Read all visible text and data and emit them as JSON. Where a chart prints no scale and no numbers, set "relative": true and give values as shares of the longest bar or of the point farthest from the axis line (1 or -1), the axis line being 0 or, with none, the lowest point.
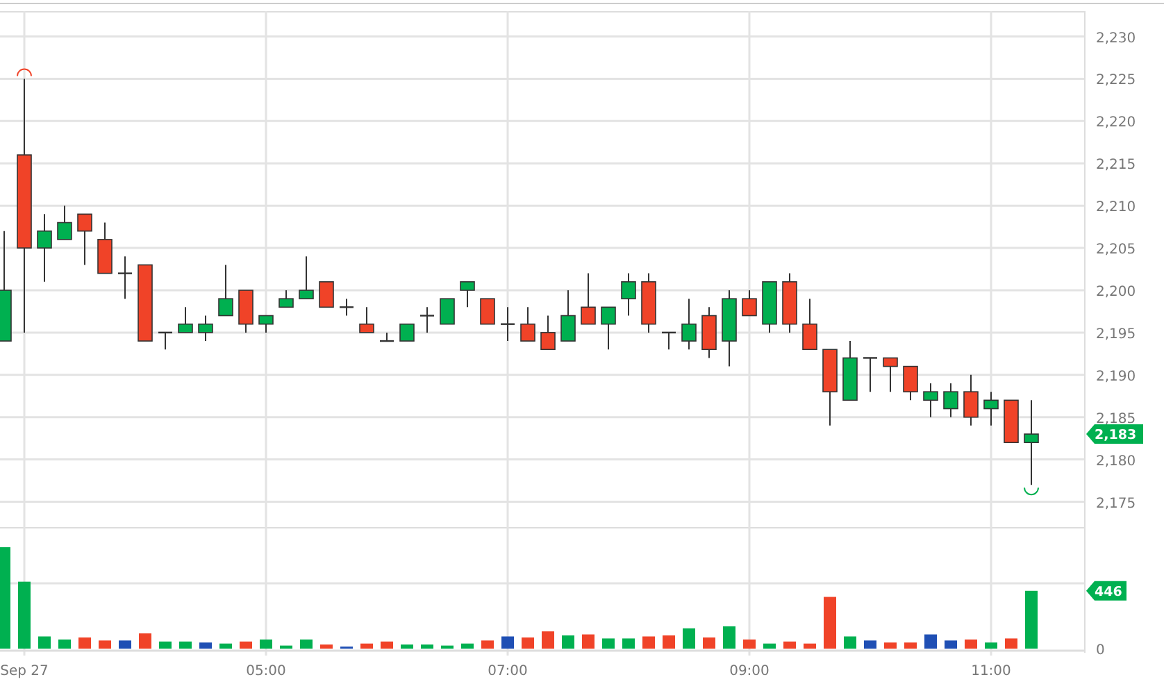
{
  "price_chart": {
    "chart_data": {
      "type": "candlestick",
      "grid": true,
      "ohlc": [
        [
          2194,
          2207,
          2194,
          2200
        ],
        [
          2216,
          2225,
          2195,
          2205
        ],
        [
          2205,
          2209,
          2201,
          2207
        ],
        [
          2206,
          2210,
          2206,
          2208
        ],
        [
          2209,
          2209,
          2203,
          2207
        ],
        [
          2206,
          2208,
          2202,
          2202
        ],
        [
          2202,
          2204,
          2199,
          2202
        ],
        [
          2203,
          2203,
          2194,
          2194
        ],
        [
          2195,
          2195,
          2193,
          2195
        ],
        [
          2195,
          2198,
          2195,
          2196
        ],
        [
          2195,
          2197,
          2194,
          2196
        ],
        [
          2197,
          2203,
          2197,
          2199
        ],
        [
          2200,
          2200,
          2195,
          2196
        ],
        [
          2196,
          2197,
          2195,
          2197
        ],
        [
          2198,
          2200,
          2198,
          2199
        ],
        [
          2199,
          2204,
          2199,
          2200
        ],
        [
          2201,
          2201,
          2198,
          2198
        ],
        [
          2198,
          2199,
          2197,
          2198
        ],
        [
          2196,
          2198,
          2195,
          2195
        ],
        [
          2194,
          2195,
          2194,
          2194
        ],
        [
          2194,
          2196,
          2194,
          2196
        ],
        [
          2197,
          2198,
          2195,
          2197
        ],
        [
          2196,
          2199,
          2196,
          2199
        ],
        [
          2200,
          2201,
          2198,
          2201
        ],
        [
          2199,
          2199,
          2196,
          2196
        ],
        [
          2196,
          2198,
          2194,
          2196
        ],
        [
          2196,
          2198,
          2194,
          2194
        ],
        [
          2195,
          2197,
          2193,
          2193
        ],
        [
          2194,
          2200,
          2194,
          2197
        ],
        [
          2198,
          2202,
          2196,
          2196
        ],
        [
          2196,
          2198,
          2193,
          2198
        ],
        [
          2199,
          2202,
          2197,
          2201
        ],
        [
          2201,
          2202,
          2195,
          2196
        ],
        [
          2195,
          2195,
          2193,
          2195
        ],
        [
          2194,
          2199,
          2193,
          2196
        ],
        [
          2197,
          2198,
          2192,
          2193
        ],
        [
          2194,
          2200,
          2191,
          2199
        ],
        [
          2199,
          2200,
          2197,
          2197
        ],
        [
          2196,
          2201,
          2195,
          2201
        ],
        [
          2201,
          2202,
          2195,
          2196
        ],
        [
          2196,
          2199,
          2193,
          2193
        ],
        [
          2193,
          2193,
          2184,
          2188
        ],
        [
          2187,
          2194,
          2187,
          2192
        ],
        [
          2192,
          2192,
          2188,
          2192
        ],
        [
          2192,
          2192,
          2188,
          2191
        ],
        [
          2191,
          2191,
          2187,
          2188
        ],
        [
          2187,
          2189,
          2185,
          2188
        ],
        [
          2186,
          2189,
          2185,
          2188
        ],
        [
          2188,
          2190,
          2184,
          2185
        ],
        [
          2186,
          2188,
          2184,
          2187
        ],
        [
          2187,
          2187,
          2182,
          2182
        ],
        [
          2182,
          2187,
          2177,
          2183
        ]
      ],
      "ylim": [
        2172.25,
        2233
      ],
      "yticks": [
        {
          "value": 2230,
          "label": "2,230"
        },
        {
          "value": 2225,
          "label": "2,225"
        },
        {
          "value": 2220,
          "label": "2,220"
        },
        {
          "value": 2215,
          "label": "2,215"
        },
        {
          "value": 2210,
          "label": "2,210"
        },
        {
          "value": 2205,
          "label": "2,205"
        },
        {
          "value": 2200,
          "label": "2,200"
        },
        {
          "value": 2195,
          "label": "2,195"
        },
        {
          "value": 2190,
          "label": "2,190"
        },
        {
          "value": 2185,
          "label": "2,185"
        },
        {
          "value": 2180,
          "label": "2,180"
        },
        {
          "value": 2175,
          "label": "2,175"
        }
      ],
      "annotations": [
        "2,183"
      ]
    }
  },
  "volume_chart": {
    "chart_data": {
      "type": "bar",
      "relative": true,
      "grid": true,
      "categories": [
        null,
        "Sep 27",
        null,
        null,
        null,
        null,
        null,
        null,
        null,
        null,
        null,
        null,
        null,
        "05:00",
        null,
        null,
        null,
        null,
        null,
        null,
        null,
        null,
        null,
        null,
        null,
        "07:00",
        null,
        null,
        null,
        null,
        null,
        null,
        null,
        null,
        null,
        null,
        null,
        "09:00",
        null,
        null,
        null,
        null,
        null,
        null,
        null,
        null,
        null,
        null,
        null,
        "11:00",
        null,
        null
      ],
      "series": [
        {
          "color": "#00b050",
          "values": [
            1,
            0.66,
            0.12,
            0.09,
            null,
            null,
            null,
            null,
            0.07,
            0.07,
            null,
            0.05,
            null,
            0.09,
            0.03,
            0.09,
            null,
            null,
            null,
            null,
            0.04,
            0.04,
            0.03,
            0.05,
            null,
            null,
            null,
            null,
            0.13,
            null,
            0.1,
            0.1,
            null,
            null,
            0.2,
            null,
            0.22,
            null,
            0.05,
            null,
            null,
            null,
            0.12,
            null,
            null,
            null,
            null,
            null,
            null,
            0.06,
            null,
            0.57
          ]
        },
        {
          "color": "#f04328",
          "values": [
            null,
            null,
            null,
            null,
            0.11,
            0.08,
            null,
            0.15,
            null,
            null,
            null,
            null,
            0.07,
            null,
            null,
            null,
            0.04,
            null,
            0.05,
            0.07,
            null,
            null,
            null,
            null,
            0.08,
            null,
            0.11,
            0.17,
            null,
            0.14,
            null,
            null,
            0.12,
            0.13,
            null,
            0.11,
            null,
            0.09,
            null,
            0.07,
            0.05,
            0.51,
            null,
            null,
            0.06,
            0.06,
            null,
            null,
            0.09,
            null,
            0.1,
            null
          ]
        },
        {
          "color": "#1f4fb4",
          "values": [
            null,
            null,
            null,
            null,
            null,
            null,
            0.08,
            null,
            null,
            null,
            0.06,
            null,
            null,
            null,
            null,
            null,
            null,
            0.02,
            null,
            null,
            null,
            null,
            null,
            null,
            null,
            0.12,
            null,
            null,
            null,
            null,
            null,
            null,
            null,
            null,
            null,
            null,
            null,
            null,
            null,
            null,
            null,
            null,
            null,
            0.08,
            null,
            null,
            0.14,
            0.08,
            null,
            null,
            null,
            null
          ]
        }
      ],
      "annotations": [
        "0",
        "446"
      ]
    }
  }
}
